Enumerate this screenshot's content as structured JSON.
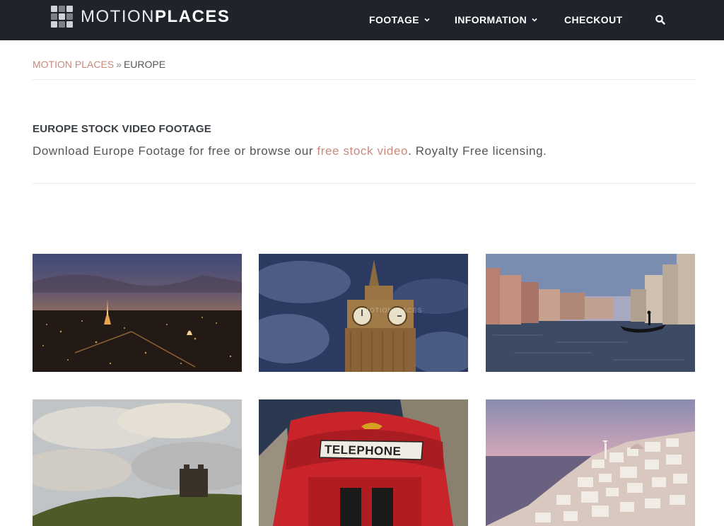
{
  "header": {
    "logo_light": "MOTION",
    "logo_bold": "PLACES",
    "nav": [
      {
        "label": "FOOTAGE",
        "has_dropdown": true
      },
      {
        "label": "INFORMATION",
        "has_dropdown": true
      },
      {
        "label": "CHECKOUT",
        "has_dropdown": false
      }
    ],
    "search_icon": "search-icon",
    "colors": {
      "bar": "#1f242c",
      "text": "#ffffff"
    }
  },
  "breadcrumb": {
    "home": "MOTION PLACES",
    "separator": "»",
    "current": "EUROPE"
  },
  "intro": {
    "title": "EUROPE STOCK VIDEO FOOTAGE",
    "text_before": "Download Europe Footage for free or browse our ",
    "link": "free stock video",
    "text_after": ". Royalty Free licensing."
  },
  "thumbnails": [
    {
      "subject": "Paris skyline at dusk with Eiffel Tower"
    },
    {
      "subject": "Big Ben clock tower against cloudy sky",
      "watermark": "MOTIONPLACES"
    },
    {
      "subject": "Venice Grand Canal with gondola"
    },
    {
      "subject": "Castle tower on grassy hill under cloudy sky"
    },
    {
      "subject": "Red London telephone box",
      "sign": "TELEPHONE"
    },
    {
      "subject": "Santorini white village on cliff at dusk"
    }
  ],
  "colors": {
    "accent": "#c98a7c"
  }
}
